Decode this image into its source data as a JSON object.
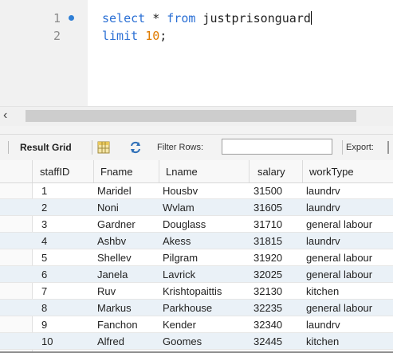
{
  "editor": {
    "line_numbers": [
      "1",
      "2"
    ],
    "line1": {
      "kw1": "select",
      "op": " * ",
      "kw2": "from",
      "table": " justprisonguard"
    },
    "line2": {
      "kw": "limit",
      "num": "10",
      "end": ";"
    }
  },
  "toolbar": {
    "result_grid_label": "Result Grid",
    "filter_label": "Filter Rows:",
    "filter_value": "",
    "export_label": "Export:"
  },
  "table": {
    "columns": [
      "staffID",
      "Fname",
      "Lname",
      "salary",
      "workType"
    ],
    "rows": [
      [
        "1",
        "Maridel",
        "Housbv",
        "31500",
        "laundrv"
      ],
      [
        "2",
        "Noni",
        "Wvlam",
        "31605",
        "laundrv"
      ],
      [
        "3",
        "Gardner",
        "Douglass",
        "31710",
        "general labour"
      ],
      [
        "4",
        "Ashbv",
        "Akess",
        "31815",
        "laundrv"
      ],
      [
        "5",
        "Shellev",
        "Pilgram",
        "31920",
        "general labour"
      ],
      [
        "6",
        "Janela",
        "Lavrick",
        "32025",
        "general labour"
      ],
      [
        "7",
        "Ruv",
        "Krishtopaittis",
        "32130",
        "kitchen"
      ],
      [
        "8",
        "Markus",
        "Parkhouse",
        "32235",
        "general labour"
      ],
      [
        "9",
        "Fanchon",
        "Kender",
        "32340",
        "laundrv"
      ],
      [
        "10",
        "Alfred",
        "Goomes",
        "32445",
        "kitchen"
      ]
    ]
  },
  "colors": {
    "keyword": "#2a6fd4",
    "number": "#e07b00",
    "alt_row": "#eaf1f7"
  }
}
